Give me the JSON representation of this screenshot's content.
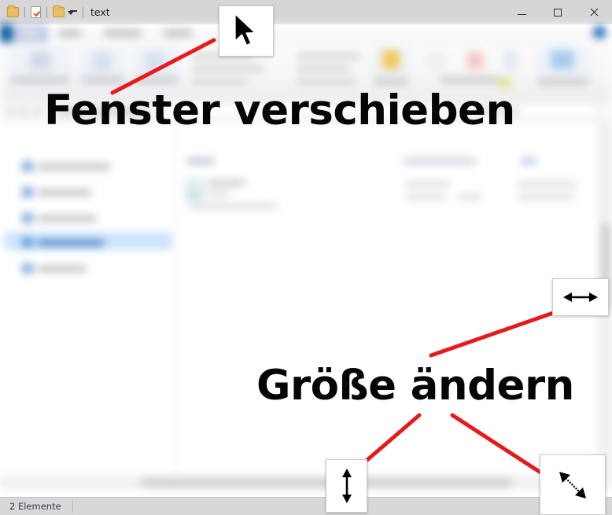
{
  "window": {
    "title": "text",
    "quick_access": [
      {
        "icon": "folder-icon",
        "name": "qat-folder-1"
      },
      {
        "icon": "properties-document-icon",
        "name": "qat-properties"
      },
      {
        "icon": "folder-icon",
        "name": "qat-new-folder"
      },
      {
        "icon": "chevron-down-icon",
        "name": "qat-customize"
      }
    ],
    "controls": {
      "minimize": "minimize-icon",
      "maximize": "maximize-icon",
      "close": "close-icon"
    }
  },
  "statusbar": {
    "items_text": "2 Elemente"
  },
  "annotations": {
    "move_label": "Fenster verschieben",
    "resize_label": "Größe ändern",
    "line_color": "#e8191b",
    "cursors": [
      {
        "name": "arrow-pointer-cursor",
        "glyph": "arrow"
      },
      {
        "name": "resize-horizontal-cursor",
        "glyph": "ew-arrow"
      },
      {
        "name": "resize-vertical-cursor",
        "glyph": "ns-arrow"
      },
      {
        "name": "resize-diagonal-cursor",
        "glyph": "nwse-arrow"
      }
    ]
  },
  "theme": {
    "titlebar_bg": "#d6d6d6",
    "accent_blue": "#005a9e",
    "selection_blue": "#cde4fb",
    "status_bg": "#d8d8d8",
    "annotation_red": "#e8191b"
  }
}
